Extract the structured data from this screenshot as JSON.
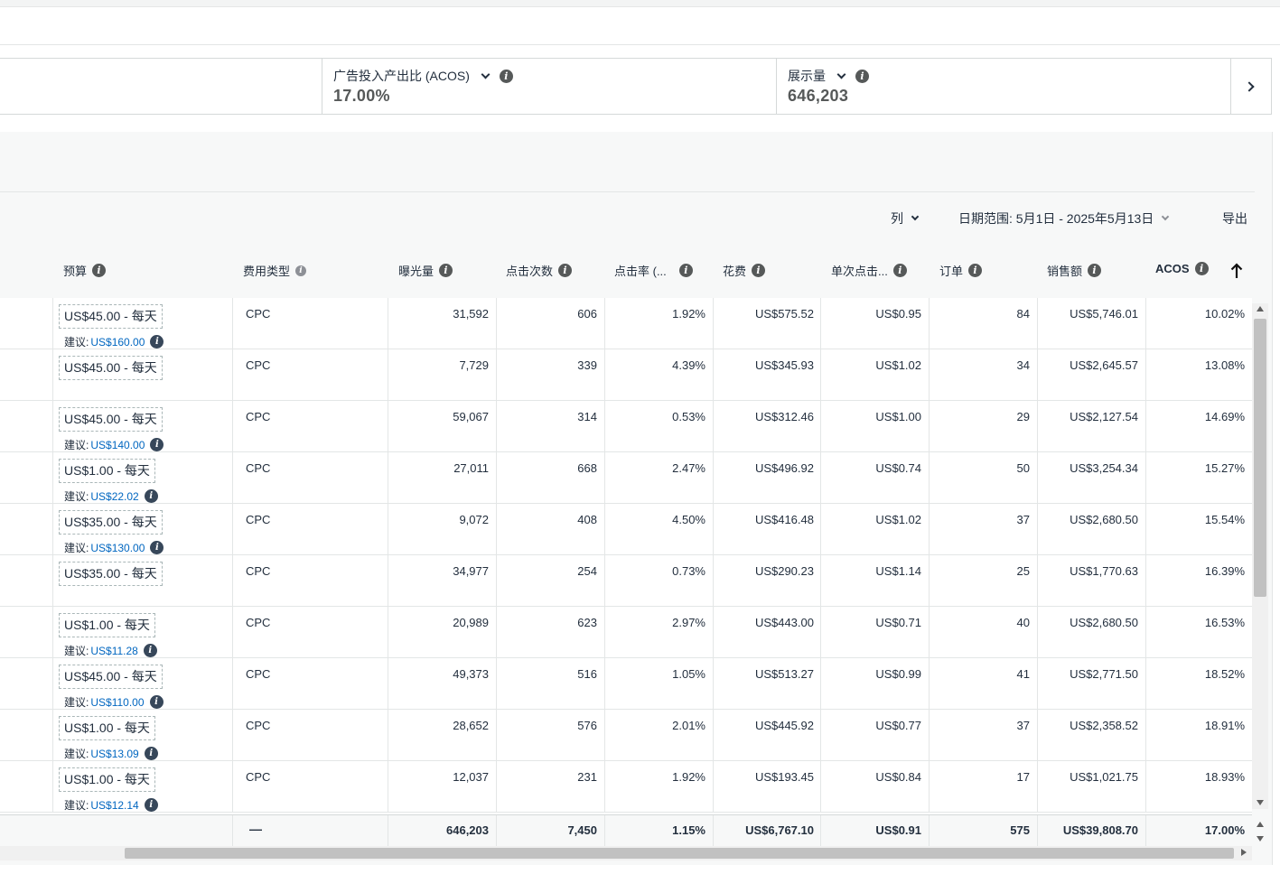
{
  "metrics": [
    {
      "label": "广告投入产出比 (ACOS)",
      "value": "17.00%"
    },
    {
      "label": "展示量",
      "value": "646,203"
    }
  ],
  "toolbar": {
    "columns_label": "列",
    "date_range_label": "日期范围: 5月1日 - 2025年5月13日",
    "export_label": "导出"
  },
  "headers": {
    "budget": "预算",
    "cost_type": "费用类型",
    "impressions": "曝光量",
    "clicks": "点击次数",
    "ctr": "点击率 (...",
    "spend": "花费",
    "cpc": "单次点击...",
    "orders": "订单",
    "sales": "销售额",
    "acos": "ACOS"
  },
  "suggestion_prefix": "建议:",
  "rows": [
    {
      "budget": "US$45.00 - 每天",
      "suggested": "US$160.00",
      "cost_type": "CPC",
      "impressions": "31,592",
      "clicks": "606",
      "ctr": "1.92%",
      "spend": "US$575.52",
      "cpc": "US$0.95",
      "orders": "84",
      "sales": "US$5,746.01",
      "acos": "10.02%"
    },
    {
      "budget": "US$45.00 - 每天",
      "suggested": "",
      "cost_type": "CPC",
      "impressions": "7,729",
      "clicks": "339",
      "ctr": "4.39%",
      "spend": "US$345.93",
      "cpc": "US$1.02",
      "orders": "34",
      "sales": "US$2,645.57",
      "acos": "13.08%"
    },
    {
      "budget": "US$45.00 - 每天",
      "suggested": "US$140.00",
      "cost_type": "CPC",
      "impressions": "59,067",
      "clicks": "314",
      "ctr": "0.53%",
      "spend": "US$312.46",
      "cpc": "US$1.00",
      "orders": "29",
      "sales": "US$2,127.54",
      "acos": "14.69%"
    },
    {
      "budget": "US$1.00 - 每天",
      "suggested": "US$22.02",
      "cost_type": "CPC",
      "impressions": "27,011",
      "clicks": "668",
      "ctr": "2.47%",
      "spend": "US$496.92",
      "cpc": "US$0.74",
      "orders": "50",
      "sales": "US$3,254.34",
      "acos": "15.27%"
    },
    {
      "budget": "US$35.00 - 每天",
      "suggested": "US$130.00",
      "cost_type": "CPC",
      "impressions": "9,072",
      "clicks": "408",
      "ctr": "4.50%",
      "spend": "US$416.48",
      "cpc": "US$1.02",
      "orders": "37",
      "sales": "US$2,680.50",
      "acos": "15.54%"
    },
    {
      "budget": "US$35.00 - 每天",
      "suggested": "",
      "cost_type": "CPC",
      "impressions": "34,977",
      "clicks": "254",
      "ctr": "0.73%",
      "spend": "US$290.23",
      "cpc": "US$1.14",
      "orders": "25",
      "sales": "US$1,770.63",
      "acos": "16.39%"
    },
    {
      "budget": "US$1.00 - 每天",
      "suggested": "US$11.28",
      "cost_type": "CPC",
      "impressions": "20,989",
      "clicks": "623",
      "ctr": "2.97%",
      "spend": "US$443.00",
      "cpc": "US$0.71",
      "orders": "40",
      "sales": "US$2,680.50",
      "acos": "16.53%"
    },
    {
      "budget": "US$45.00 - 每天",
      "suggested": "US$110.00",
      "cost_type": "CPC",
      "impressions": "49,373",
      "clicks": "516",
      "ctr": "1.05%",
      "spend": "US$513.27",
      "cpc": "US$0.99",
      "orders": "41",
      "sales": "US$2,771.50",
      "acos": "18.52%"
    },
    {
      "budget": "US$1.00 - 每天",
      "suggested": "US$13.09",
      "cost_type": "CPC",
      "impressions": "28,652",
      "clicks": "576",
      "ctr": "2.01%",
      "spend": "US$445.92",
      "cpc": "US$0.77",
      "orders": "37",
      "sales": "US$2,358.52",
      "acos": "18.91%"
    },
    {
      "budget": "US$1.00 - 每天",
      "suggested": "US$12.14",
      "cost_type": "CPC",
      "impressions": "12,037",
      "clicks": "231",
      "ctr": "1.92%",
      "spend": "US$193.45",
      "cpc": "US$0.84",
      "orders": "17",
      "sales": "US$1,021.75",
      "acos": "18.93%"
    }
  ],
  "totals": {
    "cost_type": "—",
    "impressions": "646,203",
    "clicks": "7,450",
    "ctr": "1.15%",
    "spend": "US$6,767.10",
    "cpc": "US$0.91",
    "orders": "575",
    "sales": "US$39,808.70",
    "acos": "17.00%"
  },
  "icons": {
    "info": "info-circle-icon",
    "dropdown": "chevron-down-icon",
    "next": "chevron-right-icon",
    "sort": "arrow-up-icon"
  },
  "colors": {
    "link": "#0066c0",
    "text": "#232f3e",
    "muted": "#565959",
    "border": "#d5d9d9"
  }
}
